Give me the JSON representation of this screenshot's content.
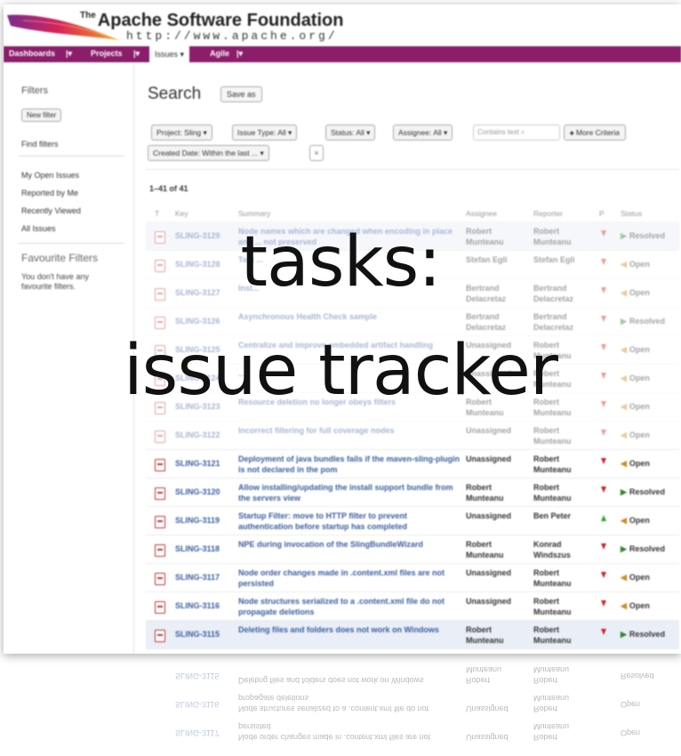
{
  "header": {
    "org_prefix": "The",
    "org_name": "Apache Software Foundation",
    "url": "http://www.apache.org/"
  },
  "nav": {
    "items": [
      {
        "label": "Dashboards",
        "active": false
      },
      {
        "label": "Projects",
        "active": false
      },
      {
        "label": "Issues",
        "active": true
      },
      {
        "label": "Agile",
        "active": false
      }
    ]
  },
  "sidebar": {
    "title": "Filters",
    "new_filter": "New filter",
    "find_filters": "Find filters",
    "links": [
      "My Open Issues",
      "Reported by Me",
      "Recently Viewed",
      "All Issues"
    ],
    "favourite_title": "Favourite Filters",
    "favourite_note": "You don't have any favourite filters."
  },
  "search": {
    "title": "Search",
    "save_as": "Save as",
    "filters": [
      "Project: Sling ▾",
      "Issue Type: All ▾",
      "Status: All ▾",
      "Assignee: All ▾"
    ],
    "text_placeholder": "Contains text",
    "more_criteria": "♠ More Criteria",
    "created_filter": "Created Date: Within the last ... ▾",
    "clear": "×",
    "count": "1–41 of 41"
  },
  "table": {
    "columns": [
      "T",
      "Key",
      "Summary",
      "Assignee",
      "Reporter",
      "P",
      "Status"
    ],
    "rows": [
      {
        "key": "SLING-3129",
        "summary": "Node names which are changed when encoding in place and ... not preserved",
        "assignee": "Robert Munteanu",
        "reporter": "Robert Munteanu",
        "priority": "major",
        "status": "Resolved"
      },
      {
        "key": "SLING-3128",
        "summary": "Test ... ",
        "assignee": "Stefan Egli",
        "reporter": "Stefan Egli",
        "priority": "major",
        "status": "Open"
      },
      {
        "key": "SLING-3127",
        "summary": "Inst... ",
        "assignee": "Bertrand Delacretaz",
        "reporter": "Bertrand Delacretaz",
        "priority": "major",
        "status": "Open"
      },
      {
        "key": "SLING-3126",
        "summary": "Asynchronous Health Check sample",
        "assignee": "Bertrand Delacretaz",
        "reporter": "Bertrand Delacretaz",
        "priority": "major",
        "status": "Resolved"
      },
      {
        "key": "SLING-3125",
        "summary": "Centralize and improve embedded artifact handling",
        "assignee": "Unassigned",
        "reporter": "Robert Munteanu",
        "priority": "major",
        "status": "Open"
      },
      {
        "key": "SLING-3124",
        "summary": "... ",
        "assignee": "Unassigned",
        "reporter": "Robert Munteanu",
        "priority": "major",
        "status": "Open"
      },
      {
        "key": "SLING-3123",
        "summary": "Resource deletion no longer obeys filters",
        "assignee": "Robert Munteanu",
        "reporter": "Robert Munteanu",
        "priority": "major",
        "status": "Open"
      },
      {
        "key": "SLING-3122",
        "summary": "Incorrect filtering for full coverage nodes",
        "assignee": "Unassigned",
        "reporter": "Robert Munteanu",
        "priority": "major",
        "status": "Open"
      },
      {
        "key": "SLING-3121",
        "summary": "Deployment of java bundles fails if the maven-sling-plugin is not declared in the pom",
        "assignee": "Unassigned",
        "reporter": "Robert Munteanu",
        "priority": "major",
        "status": "Open"
      },
      {
        "key": "SLING-3120",
        "summary": "Allow installing/updating the install support bundle from the servers view",
        "assignee": "Robert Munteanu",
        "reporter": "Robert Munteanu",
        "priority": "major",
        "status": "Resolved"
      },
      {
        "key": "SLING-3119",
        "summary": "Startup Filter: move to HTTP filter to prevent authentication before startup has completed",
        "assignee": "Unassigned",
        "reporter": "Ben Peter",
        "priority": "minor",
        "status": "Open"
      },
      {
        "key": "SLING-3118",
        "summary": "NPE during invocation of the SlingBundleWizard",
        "assignee": "Robert Munteanu",
        "reporter": "Konrad Windszus",
        "priority": "major",
        "status": "Resolved"
      },
      {
        "key": "SLING-3117",
        "summary": "Node order changes made in .content.xml files are not persisted",
        "assignee": "Unassigned",
        "reporter": "Robert Munteanu",
        "priority": "major",
        "status": "Open"
      },
      {
        "key": "SLING-3116",
        "summary": "Node structures serialized to a .content.xml file do not propagate deletions",
        "assignee": "Unassigned",
        "reporter": "Robert Munteanu",
        "priority": "major",
        "status": "Open"
      },
      {
        "key": "SLING-3115",
        "summary": "Deleting files and folders does not work on Windows",
        "assignee": "Robert Munteanu",
        "reporter": "Robert Munteanu",
        "priority": "major",
        "status": "Resolved"
      }
    ]
  },
  "overlay": {
    "line1": "tasks:",
    "line2": "issue tracker"
  },
  "colors": {
    "nav_bg": "#8b1d6b",
    "link": "#3b5fa0",
    "resolved": "#2a8a2a",
    "open": "#d08a1a"
  }
}
